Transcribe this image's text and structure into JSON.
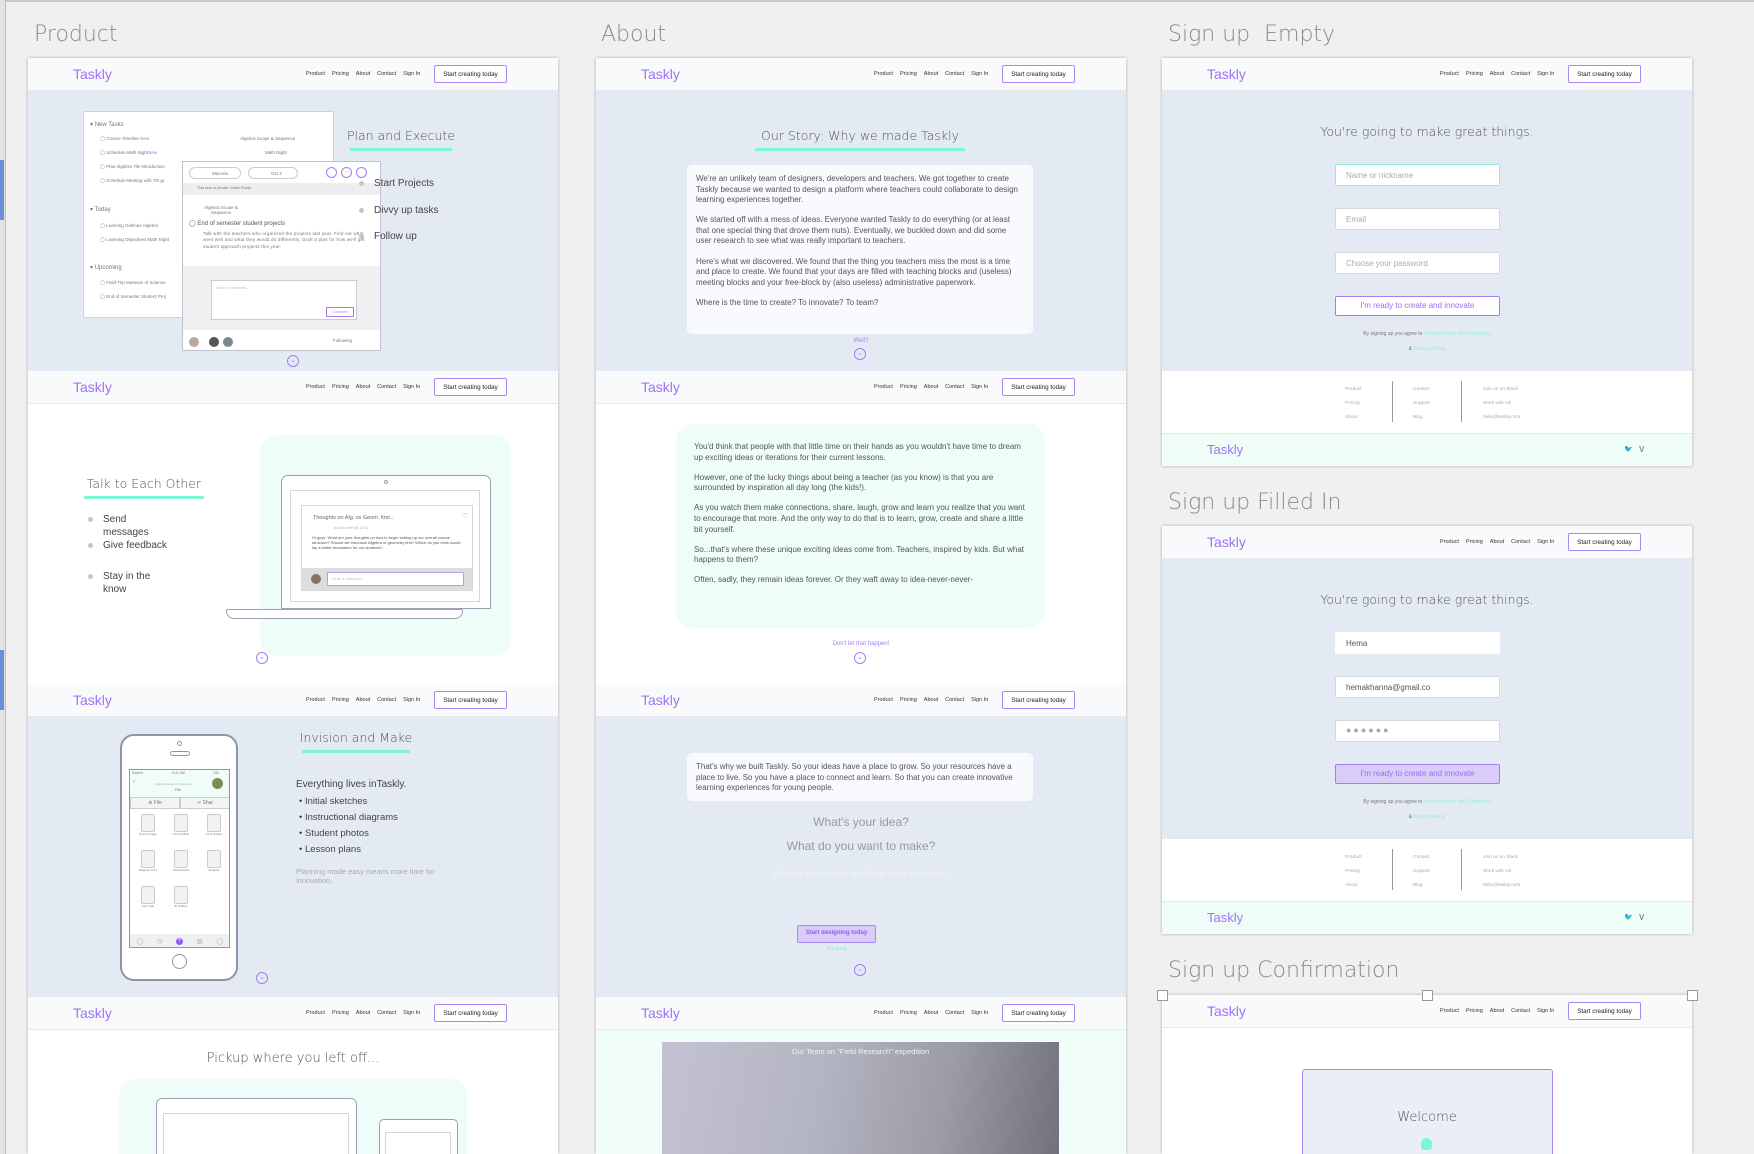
{
  "nav": {
    "logo": "Taskly",
    "links": [
      "Product",
      "Pricing",
      "About",
      "Contact",
      "Sign In"
    ],
    "cta": "Start creating today"
  },
  "artboards": {
    "product": "Product",
    "about": "About",
    "signup_empty": "Sign up  Empty",
    "signup_filled": "Sign up Filled In",
    "signup_confirmation": "Sign up Confirmation"
  },
  "product": {
    "plan": {
      "title": "Plan and Execute",
      "bullets": [
        "Start Projects",
        "Divvy up tasks",
        "Follow up"
      ],
      "tasklist": {
        "groups": [
          "New Tasks",
          "Today",
          "Upcoming"
        ],
        "new": [
          {
            "name": "Course Timeline",
            "badge": "New",
            "project": "Algebra Scope & Sequence"
          },
          {
            "name": "Schedule Math Night",
            "badge": "New",
            "project": "Math Night"
          },
          {
            "name": "Plan Algebra Tile Introduction"
          },
          {
            "name": "Schedule Meeting with 7th gr"
          }
        ],
        "today": [
          "Learning Outlines Algebra",
          "Learning Objectives Math Night"
        ],
        "upcoming": [
          "Field Trip Museum of Science",
          "End of Semester Student Proj"
        ]
      },
      "detail": {
        "assignee": "Marcela",
        "date": "Oct 4",
        "privacy": "This task is private. Make Public",
        "project": "Algebra Scope & Sequence",
        "task": "End of semester student projects",
        "description": "Talk with the teachers who organized the projects last year. Find out what went well and what they would do differently. Draft a plan for how we'll get student approach projects this year.",
        "comment_placeholder": "Write a comment...",
        "comment_button": "Commen",
        "follow": "Following"
      }
    },
    "talk": {
      "title": "Talk to Each Other",
      "bullets": [
        "Send messages",
        "Give feedback",
        "Stay in the know"
      ],
      "post": {
        "title": "Thoughts on Alg. vs Geom. first...",
        "byline": "by Chin Yeet @ 12:34",
        "body": "Hi guys. What are your thoughts on how to begin setting up our overall course structure? Should we introduce Algebra or geometry first?  Which do you think would lay a better foundation for our students?",
        "comment_placeholder": "Write a comment..."
      }
    },
    "invision": {
      "title": "Invision and Make",
      "lead": "Everything lives inTaskly.",
      "bullets": [
        "Initial sketches",
        "Instructional diagrams",
        "Student photos",
        "Lesson plans"
      ],
      "note": "Planning made easy means more time for innovation.",
      "phone": {
        "carrier": "Sketch",
        "time": "9:41 AM",
        "battery": "100",
        "header": "Algebra Scope & Sequence",
        "sub": "File",
        "tabs": [
          "File",
          "Shar"
        ],
        "files": [
          "Seven Image",
          "Ch 2 Outline",
          "Ch 3 Outline",
          "Diagram Ch 2",
          "Assessment",
          "Projects",
          "Last Year",
          "8l Outline"
        ]
      }
    },
    "pickup": {
      "title": "Pickup where you left off..."
    }
  },
  "about": {
    "story_title": "Our Story: Why we made Taskly",
    "story": [
      "We're an unlikely team of designers, developers and teachers. We got together to create Taskly because we wanted to design a platform where teachers could collaborate to design learning experiences together.",
      "We started off with a mess of ideas. Everyone wanted Taskly to do everything (or at least that one special thing that drove them nuts). Eventually, we buckled down and did some user research to see what was really important to teachers.",
      "Here's what we discovered. We found that the thing you teachers miss the most is a time and place to create. We found that your days are filled with teaching blocks and (useless) meeting blocks and your free-block by (also useless) administrative paperwork.",
      "Where is the time to create? To innovate? To team?"
    ],
    "well": "Well?",
    "story2": [
      "You'd think that people with that little time on their hands as you wouldn't have time to dream up exciting ideas or iterations for their current lessons.",
      "However, one of the lucky things about being a teacher (as you know) is that you are surrounded by inspiration all day long (the kids!).",
      "As you watch them make connections, share, laugh, grow and learn you realize that you want to encourage that more. And the only way to do that is to learn, grow, create and share a little bit yourself.",
      "So...that's where these unique exciting ideas come from. Teachers, inspired by kids. But what happens to them?",
      "Often, sadly, they remain ideas forever. Or they waft away to idea-never-never-"
    ],
    "dont": "Don't let that happen!",
    "built": "That's why we built Taskly. So your ideas have a place to grow. So your resources have a place to live. So you have a place to connect and learn. So that you can create innovative learning experiences for young people.",
    "q1": "What's your idea?",
    "q2": "What do you want to make?",
    "aside": "(Don't let another idea slip off into never-never land.)",
    "cta": "Start designing today",
    "free": "(It's free!)",
    "photo_caption": "Our Team on \"Field Research\" expedition"
  },
  "signup": {
    "heading": "You're going to make great things.",
    "placeholders": {
      "name": "Name or nickname",
      "email": "Email",
      "password": "Choose your password"
    },
    "filled": {
      "name": "Hema",
      "email": "hemakhanna@gmail.co",
      "password": "●●●●●●"
    },
    "button": "I'm ready to create and innovate",
    "terms_prefix": "By signing up you agree to ",
    "terms_link": "Taskly's Terms and Conditions",
    "amp": "& ",
    "privacy_link": "Privacy Policy",
    "period": ".",
    "footer_cols": [
      [
        "Product",
        "Pricing",
        "About"
      ],
      [
        "Contact",
        "Support",
        "Blog"
      ],
      [
        "Join us on Slack",
        "Work with Us",
        "hello@taskly.com"
      ]
    ],
    "social": [
      "twitter-icon",
      "vimeo-icon"
    ],
    "social_glyphs": {
      "twitter": "🐦",
      "vimeo": "V"
    },
    "welcome": "Welcome"
  },
  "colors": {
    "purple": "#9d72f5",
    "mint": "#7ff5d7",
    "section_blue": "#e4eaf3"
  }
}
